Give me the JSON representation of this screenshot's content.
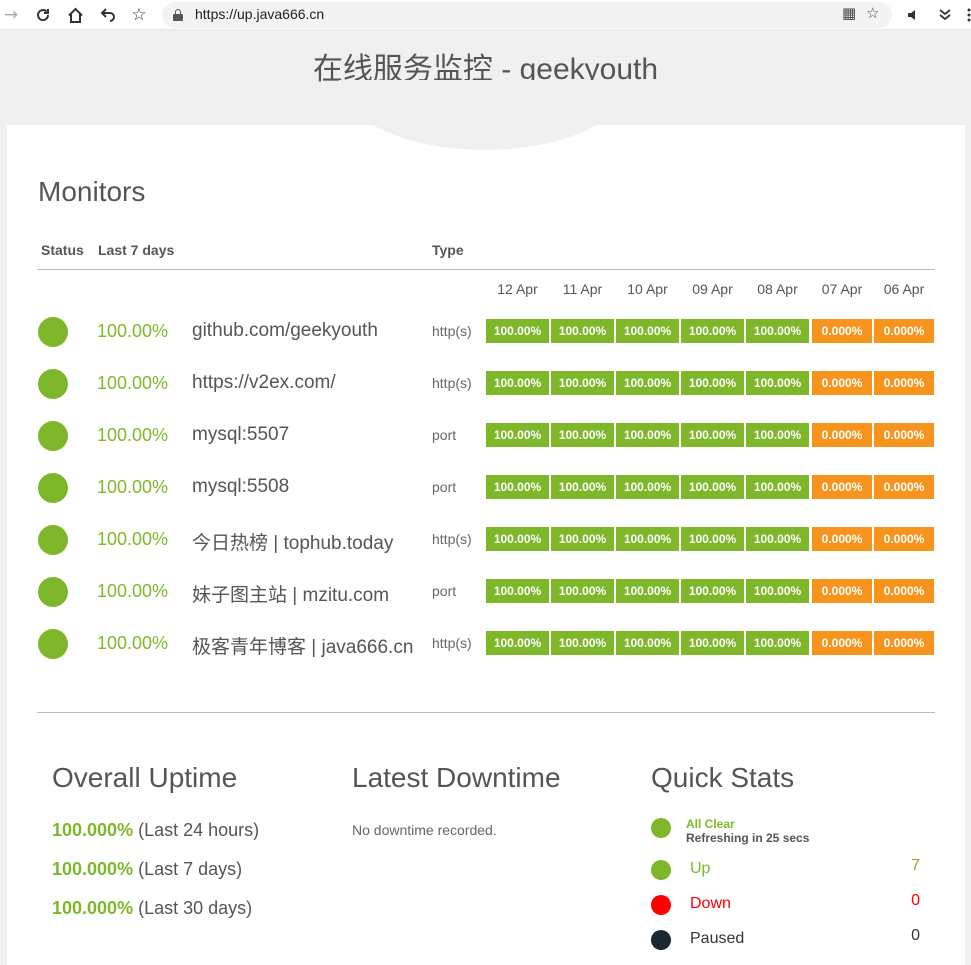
{
  "browser": {
    "url": "https://up.java666.cn"
  },
  "page": {
    "title": "在线服务监控 - geekyouth"
  },
  "monitors": {
    "heading": "Monitors",
    "headers": {
      "status": "Status",
      "last7": "Last 7 days",
      "type": "Type"
    },
    "dates": [
      "12 Apr",
      "11 Apr",
      "10 Apr",
      "09 Apr",
      "08 Apr",
      "07 Apr",
      "06 Apr"
    ],
    "rows": [
      {
        "pct": "100.00%",
        "name": "github.com/geekyouth",
        "type": "http(s)",
        "days": [
          "100.00%",
          "100.00%",
          "100.00%",
          "100.00%",
          "100.00%",
          "0.000%",
          "0.000%"
        ]
      },
      {
        "pct": "100.00%",
        "name": "https://v2ex.com/",
        "type": "http(s)",
        "days": [
          "100.00%",
          "100.00%",
          "100.00%",
          "100.00%",
          "100.00%",
          "0.000%",
          "0.000%"
        ]
      },
      {
        "pct": "100.00%",
        "name": "mysql:5507",
        "type": "port",
        "days": [
          "100.00%",
          "100.00%",
          "100.00%",
          "100.00%",
          "100.00%",
          "0.000%",
          "0.000%"
        ]
      },
      {
        "pct": "100.00%",
        "name": "mysql:5508",
        "type": "port",
        "days": [
          "100.00%",
          "100.00%",
          "100.00%",
          "100.00%",
          "100.00%",
          "0.000%",
          "0.000%"
        ]
      },
      {
        "pct": "100.00%",
        "name": "今日热榜 | tophub.today",
        "type": "http(s)",
        "days": [
          "100.00%",
          "100.00%",
          "100.00%",
          "100.00%",
          "100.00%",
          "0.000%",
          "0.000%"
        ]
      },
      {
        "pct": "100.00%",
        "name": "妹子图主站 | mzitu.com",
        "type": "port",
        "days": [
          "100.00%",
          "100.00%",
          "100.00%",
          "100.00%",
          "100.00%",
          "0.000%",
          "0.000%"
        ]
      },
      {
        "pct": "100.00%",
        "name": "极客青年博客 | java666.cn",
        "type": "http(s)",
        "days": [
          "100.00%",
          "100.00%",
          "100.00%",
          "100.00%",
          "100.00%",
          "0.000%",
          "0.000%"
        ]
      }
    ]
  },
  "overall": {
    "heading": "Overall Uptime",
    "lines": [
      {
        "value": "100.000%",
        "label": "(Last 24 hours)"
      },
      {
        "value": "100.000%",
        "label": "(Last 7 days)"
      },
      {
        "value": "100.000%",
        "label": "(Last 30 days)"
      }
    ]
  },
  "downtime": {
    "heading": "Latest Downtime",
    "text": "No downtime recorded."
  },
  "quickstats": {
    "heading": "Quick Stats",
    "status": "All Clear",
    "refresh": "Refreshing in 25 secs",
    "up_label": "Up",
    "up_value": "7",
    "down_label": "Down",
    "down_value": "0",
    "paused_label": "Paused",
    "paused_value": "0"
  },
  "colors": {
    "up": "#7eb82a",
    "down": "#ff0000",
    "paused": "#1a2633",
    "warn": "#f7941d"
  }
}
